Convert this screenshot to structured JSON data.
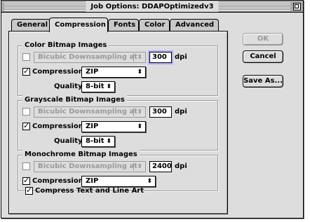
{
  "window": {
    "title": "Job Options: DDAPOptimizedv3"
  },
  "tabs": [
    {
      "label": "General"
    },
    {
      "label": "Compression"
    },
    {
      "label": "Fonts"
    },
    {
      "label": "Color"
    },
    {
      "label": "Advanced"
    }
  ],
  "active_tab": "Compression",
  "color_group": {
    "title": "Color Bitmap Images",
    "downsample_enabled": false,
    "downsample_method": "Bicubic Downsampling at",
    "resolution": "300",
    "unit": "dpi",
    "compression_enabled": true,
    "compression_label": "Compression:",
    "compression_value": "ZIP",
    "quality_label": "Quality:",
    "quality_value": "8-bit"
  },
  "grayscale_group": {
    "title": "Grayscale Bitmap Images",
    "downsample_enabled": false,
    "downsample_method": "Bicubic Downsampling at",
    "resolution": "300",
    "unit": "dpi",
    "compression_enabled": true,
    "compression_label": "Compression:",
    "compression_value": "ZIP",
    "quality_label": "Quality:",
    "quality_value": "8-bit"
  },
  "mono_group": {
    "title": "Monochrome Bitmap Images",
    "downsample_enabled": false,
    "downsample_method": "Bicubic Downsampling at",
    "resolution": "2400",
    "unit": "dpi",
    "compression_enabled": true,
    "compression_label": "Compression:",
    "compression_value": "ZIP"
  },
  "compress_text": {
    "checked": true,
    "label": "Compress Text and Line Art"
  },
  "buttons": {
    "ok": "OK",
    "cancel": "Cancel",
    "save_as": "Save As..."
  },
  "icons": {
    "popup_arrow": "updown-arrows-icon",
    "zoom_box": "zoom-box-icon"
  },
  "colors": {
    "window_bg": "#dddddd",
    "focus_ring": "#aab0ff",
    "disabled": "#9a9a9a"
  }
}
